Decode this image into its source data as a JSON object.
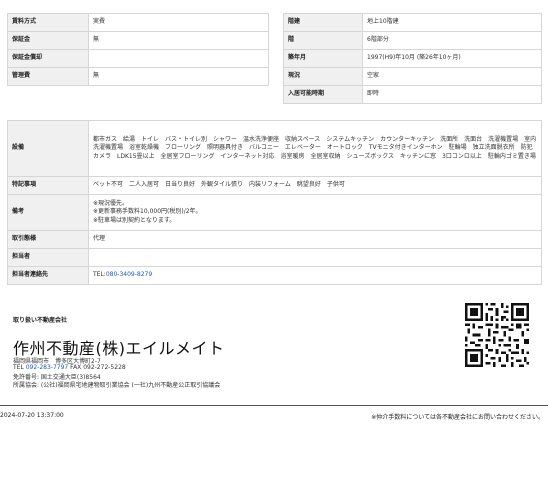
{
  "top_left": [
    {
      "label": "賃料方式",
      "value": "実費"
    },
    {
      "label": "保証金",
      "value": "無"
    },
    {
      "label": "保証金償却",
      "value": ""
    },
    {
      "label": "管理費",
      "value": "無"
    }
  ],
  "top_right": [
    {
      "label": "階建",
      "value": "地上10階建"
    },
    {
      "label": "階",
      "value": "6階部分"
    },
    {
      "label": "築年月",
      "value": "1997(H9)年10月 (築26年10ヶ月)"
    },
    {
      "label": "現況",
      "value": "空家"
    },
    {
      "label": "入居可能時期",
      "value": "即時"
    }
  ],
  "details": {
    "equipment_label": "設備",
    "equipment_value": "都市ガス　給湯　トイレ　バス・トイレ別　シャワー　温水洗浄便座　収納スペース　システムキッチン　カウンターキッチン　洗面所　洗面台　洗濯機置場　室内洗濯機置場　浴室乾燥機　フローリング　照明器具付き　バルコニー　エレベーター　オートロック　TVモニタ付きインターホン　駐輪場　独立洗面脱衣所　防犯カメラ　LDK15畳以上　全居室フローリング　インターネット対応　浴室暖房　全居室収納　シューズボックス　キッチンに窓　3口コンロ以上　駐輪内ゴミ置き場",
    "features_label": "特記事項",
    "features_value": "ペット不可　二人入居可　日当り良好　外観タイル張り　内装リフォーム　眺望良好　子供可",
    "remarks_label": "備考",
    "remarks_lines": [
      "※現況優先。",
      "※更新事務手数料10,000円(税別)/2年。",
      "※駐車場は別契約となります。"
    ],
    "transaction_label": "取引態様",
    "transaction_value": "代理",
    "person_label": "担当者",
    "person_value": "",
    "contact_label": "担当者連絡先",
    "contact_prefix": "TEL:",
    "contact_phone": "080-3409-8279"
  },
  "company": {
    "section_label": "取り扱い不動産会社",
    "name": "作州不動産(株)エイルメイト",
    "address": "福岡県福岡市　博多区大博町2-7",
    "tel_label": "TEL",
    "tel": "092-283-7797",
    "fax": "FAX 092-272-5228",
    "license": "免許番号: 国土交通大臣(3)8564",
    "association": "所属協会: (公社)福岡県宅地建物取引業協会 (一社)九州不動産公正取引協議会"
  },
  "footer": {
    "datetime": "2024-07-20 13:37:00",
    "note": "※仲介手数料については各不動産会社にお問い合わせください。"
  }
}
